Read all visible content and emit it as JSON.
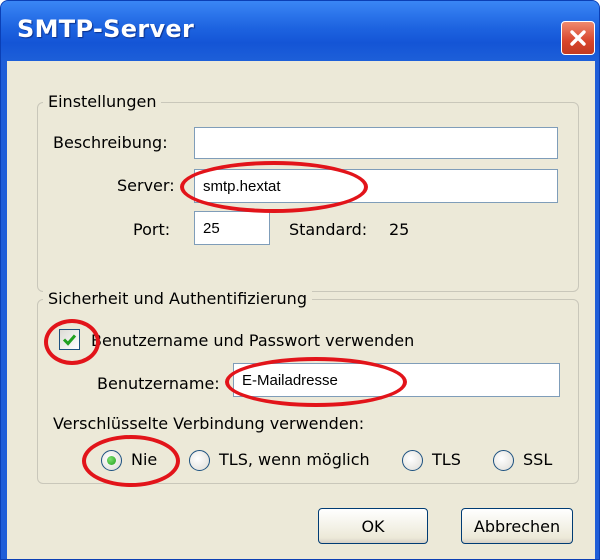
{
  "window": {
    "title": "SMTP-Server"
  },
  "settings_group": {
    "legend": "Einstellungen",
    "description_label": "Beschreibung:",
    "description_value": "",
    "server_label": "Server:",
    "server_value": "smtp.hextat",
    "port_label": "Port:",
    "port_value": "25",
    "standard_label": "Standard:",
    "standard_value": "25"
  },
  "security_group": {
    "legend": "Sicherheit und Authentifizierung",
    "use_credentials_label": "Benutzername und Passwort verwenden",
    "use_credentials_checked": true,
    "username_label": "Benutzername:",
    "username_value": "E-Mailadresse",
    "encryption_label": "Verschlüsselte Verbindung verwenden:",
    "encryption_options": [
      "Nie",
      "TLS, wenn möglich",
      "TLS",
      "SSL"
    ],
    "encryption_selected": "Nie"
  },
  "buttons": {
    "ok": "OK",
    "cancel": "Abbrechen"
  },
  "colors": {
    "highlight_ring": "#e2141a",
    "titlebar": "#1d63e0",
    "dialog_bg": "#ece9d8"
  },
  "icons": {
    "close": "close-icon",
    "check": "checkmark-icon"
  }
}
